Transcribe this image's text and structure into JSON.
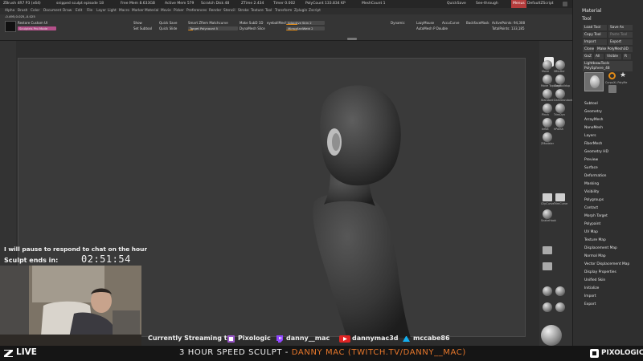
{
  "title_bar": {
    "app": "ZBrush 4R7 P3 (x64)",
    "document": "snipped sculpt episode 18",
    "free_mem": "Free Mem 8.633GB",
    "active_mem": "Active Mem 579",
    "scratch_disk": "Scratch Disk 48",
    "ztime": "ZTime 2.434",
    "timer": "Timer 0.002",
    "poly_count": "PolyCount 133.834 KP",
    "mesh_count": "MeshCount 1",
    "quicksave": "QuickSave",
    "see_through": "See-through",
    "menus": "Menus",
    "default_zscript": "DefaultZScript"
  },
  "menu_bar": {
    "items": [
      "Alpha",
      "Brush",
      "Color",
      "Document",
      "Draw",
      "Edit",
      "File",
      "Layer",
      "Light",
      "Macro",
      "Marker",
      "Material",
      "Movie",
      "Picker",
      "Preferences",
      "Render",
      "Stencil",
      "Stroke",
      "Texture",
      "Tool",
      "Transform",
      "Zplugin",
      "Zscript"
    ],
    "coords": "-0.495,0.025,-0.025"
  },
  "top_shelf": {
    "buttons": [
      {
        "id": "restore-custom-ui",
        "label": "Restore Custom UI"
      },
      {
        "id": "sculptris-pro",
        "label": "Sculptris Pro Mode"
      },
      {
        "id": "show",
        "label": "Show"
      },
      {
        "id": "set-subtool",
        "label": "Set Subtool"
      },
      {
        "id": "quick-save",
        "label": "Quick Save"
      },
      {
        "id": "quick-slide",
        "label": "Quick Slide"
      },
      {
        "id": "smart-zrem",
        "label": "Smart ZRem Matchcurve"
      },
      {
        "id": "target-polycount",
        "label": "Target Polycount 5"
      },
      {
        "id": "make-subd-1d",
        "label": "Make SubD 1D"
      },
      {
        "id": "dynamesh-slice",
        "label": "DynaMesh Slice"
      },
      {
        "id": "eyeball-mesh",
        "label": "eyeballMesh"
      },
      {
        "id": "adaptive-skin",
        "label": "Adaptive Skin 2"
      },
      {
        "id": "mirror-and-weld",
        "label": "MirrorAndWeld 2"
      },
      {
        "id": "dynamic",
        "label": "Dynamic"
      },
      {
        "id": "lazy-mouse",
        "label": "LazyMouse"
      },
      {
        "id": "lazy-radius",
        "label": "AutoMesh P Double"
      },
      {
        "id": "accu-curve",
        "label": "AccuCurve"
      },
      {
        "id": "backface-mask",
        "label": "BackfaceMask"
      },
      {
        "id": "active-points",
        "label": "ActivePoints: 94,308"
      },
      {
        "id": "total-points",
        "label": "TotalPoints: 133,185"
      }
    ]
  },
  "right_shelf": {
    "tools": [
      {
        "id": "move",
        "label": "Move"
      },
      {
        "id": "smooth",
        "label": "SBtcDer"
      },
      {
        "id": "move-topo",
        "label": "Move Topologic"
      },
      {
        "id": "clay-buildup",
        "label": "ClayBuildup"
      },
      {
        "id": "standard",
        "label": "Standard"
      },
      {
        "id": "damstandard",
        "label": "DamStandard"
      },
      {
        "id": "pinch",
        "label": "Pinch"
      },
      {
        "id": "trim-dynamic",
        "label": "TrimDyn"
      },
      {
        "id": "inflate",
        "label": "Inflat"
      },
      {
        "id": "hpolish",
        "label": "hPolish"
      },
      {
        "id": "clip-curve",
        "label": "ClipCurve"
      },
      {
        "id": "trim-curve",
        "label": "TrimCurve"
      },
      {
        "id": "snake-hook",
        "label": "SnakeHook"
      },
      {
        "id": "zmodeler",
        "label": "ZModeler"
      }
    ]
  },
  "tool_panel": {
    "material_label": "Material",
    "tool_label": "Tool",
    "buttons": [
      {
        "id": "load-tool",
        "label": "Load Tool"
      },
      {
        "id": "save-as",
        "label": "Save As"
      },
      {
        "id": "copy-tool",
        "label": "Copy Tool"
      },
      {
        "id": "paste-tool",
        "label": "Paste Tool"
      },
      {
        "id": "import",
        "label": "Import"
      },
      {
        "id": "export",
        "label": "Export"
      },
      {
        "id": "clone",
        "label": "Clone"
      },
      {
        "id": "make-polymesh",
        "label": "Make PolyMesh3D"
      },
      {
        "id": "goz",
        "label": "GoZ"
      },
      {
        "id": "all",
        "label": "All"
      },
      {
        "id": "visible",
        "label": "Visible"
      },
      {
        "id": "r",
        "label": "R"
      }
    ],
    "lightbox_tools": "Lightbox▸Tools",
    "current_tool": "PolySphere_48",
    "thumb_label": "PolySphere",
    "thumb_label2": "CorpuXL PolyMe",
    "subpalettes": [
      "Subtool",
      "Geometry",
      "ArrayMesh",
      "NanoMesh",
      "Layers",
      "FiberMesh",
      "Geometry HD",
      "Preview",
      "Surface",
      "Deformation",
      "Masking",
      "Visibility",
      "Polygroups",
      "Contact",
      "Morph Target",
      "Polypaint",
      "UV Map",
      "Texture Map",
      "Displacement Map",
      "Normal Map",
      "Vector Displacement Map",
      "Display Properties",
      "Unified Skin",
      "Initialize",
      "Import",
      "Export"
    ]
  },
  "overlay": {
    "pause_message": "I will pause to respond to chat on the hour",
    "sculpt_ends_label": "Sculpt ends in:",
    "timer": "02:51:54"
  },
  "streaming_bar": {
    "label": "Currently Streaming to",
    "pixologic": "Pixologic",
    "twitch": "danny__mac",
    "youtube": "dannymac3d",
    "artstation": "mccabe86"
  },
  "banner": {
    "live": "LIVE",
    "prefix": "3 HOUR SPEED SCULPT - ",
    "accent": "DANNY MAC (TWITCH.TV/DANNY__MAC)",
    "brand": "PIXOLOGIC"
  },
  "colors": {
    "accent_orange": "#e7772b",
    "slider_fill": "#e08a18",
    "youtube_red": "#e02424",
    "twitch_purple": "#9146ff",
    "artstation_blue": "#13aff0"
  }
}
